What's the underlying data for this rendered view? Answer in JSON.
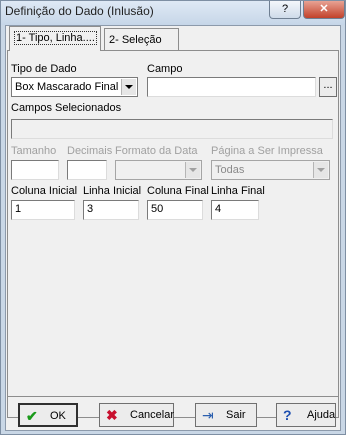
{
  "window": {
    "title": "Definição do Dado (Inlusão)",
    "help_label": "?",
    "close_label": "✕"
  },
  "tabs": [
    {
      "label": "1- Tipo, Linha...."
    },
    {
      "label": "2- Seleção"
    }
  ],
  "form": {
    "tipo_de_dado": {
      "label": "Tipo de Dado",
      "value": "Box Mascarado Final"
    },
    "campo": {
      "label": "Campo",
      "value": "",
      "button": "..."
    },
    "campos_selecionados": {
      "label": "Campos Selecionados",
      "value": ""
    },
    "tamanho": {
      "label": "Tamanho",
      "value": ""
    },
    "decimais": {
      "label": "Decimais",
      "value": ""
    },
    "formato_da_data": {
      "label": "Formato da Data",
      "value": ""
    },
    "pagina_a_ser_impressa": {
      "label": "Página a Ser Impressa",
      "value": "Todas"
    },
    "coluna_inicial": {
      "label": "Coluna Inicial",
      "value": "1"
    },
    "linha_inicial": {
      "label": "Linha Inicial",
      "value": "3"
    },
    "coluna_final": {
      "label": "Coluna Final",
      "value": "50"
    },
    "linha_final": {
      "label": "Linha Final",
      "value": "4"
    }
  },
  "buttons": {
    "ok": "OK",
    "cancelar": "Cancelar",
    "sair": "Sair",
    "ajuda": "Ajuda"
  },
  "icons": {
    "ok": "check-icon",
    "cancelar": "x-icon",
    "sair": "exit-icon",
    "ajuda": "help-icon"
  },
  "colors": {
    "ok_check": "#1a9a1a",
    "cancel_x": "#c8102e",
    "help_q": "#1e4fb0"
  }
}
